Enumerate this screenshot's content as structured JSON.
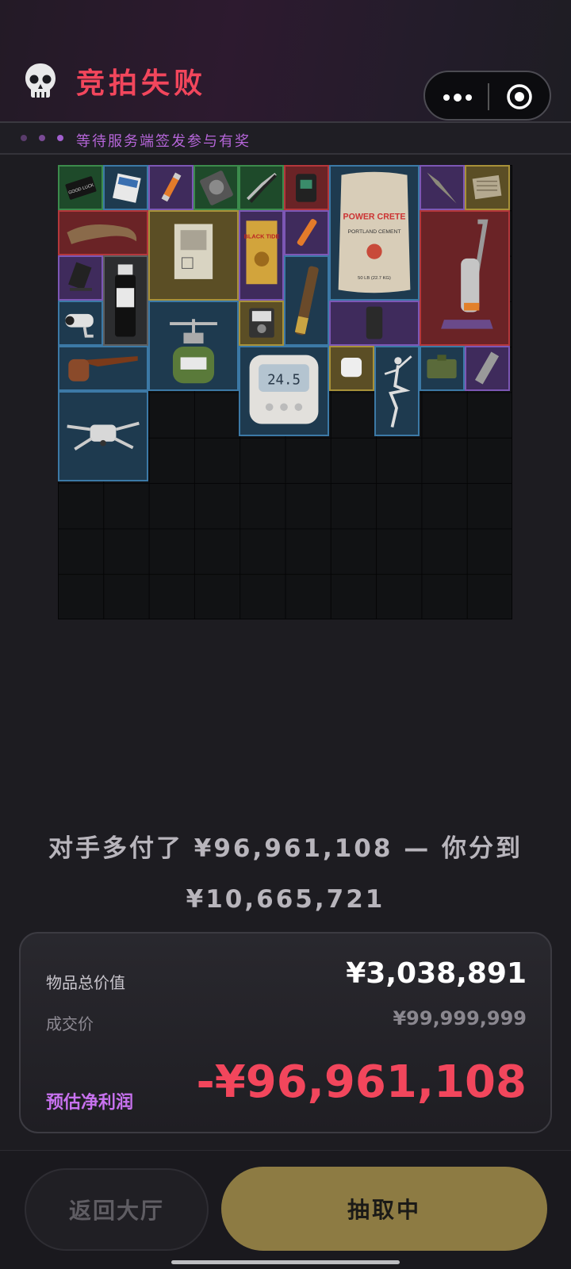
{
  "header": {
    "title": "竞拍失败",
    "status_text": "等待服务端签发参与有奖",
    "icons": [
      "skull-icon",
      "more-icon",
      "target-icon"
    ]
  },
  "inventory": {
    "grid_columns": 10,
    "grid_rows": 10,
    "items": [
      {
        "name": "good-luck-card",
        "rarity": "green",
        "label": "GOOD LUCK"
      },
      {
        "name": "memory-card",
        "rarity": "blue"
      },
      {
        "name": "fuse",
        "rarity": "purple"
      },
      {
        "name": "hard-drive",
        "rarity": "green"
      },
      {
        "name": "pliers",
        "rarity": "green"
      },
      {
        "name": "wrist-device",
        "rarity": "red"
      },
      {
        "name": "cement-bag",
        "rarity": "blue",
        "label_line1": "POWER CRETE",
        "label_line2": "PORTLAND CEMENT",
        "label_line3": "50 LB (22.7 KG)"
      },
      {
        "name": "spear-head",
        "rarity": "purple"
      },
      {
        "name": "circuit-module",
        "rarity": "gold"
      },
      {
        "name": "horn",
        "rarity": "red"
      },
      {
        "name": "document-folder",
        "rarity": "gold"
      },
      {
        "name": "black-tide-book",
        "rarity": "purple",
        "label": "BLACK TIDE"
      },
      {
        "name": "fuse-small",
        "rarity": "purple"
      },
      {
        "name": "vacuum-cleaner",
        "rarity": "red"
      },
      {
        "name": "phone-mount",
        "rarity": "purple"
      },
      {
        "name": "sample-bottle",
        "rarity": "gray"
      },
      {
        "name": "telescope",
        "rarity": "blue"
      },
      {
        "name": "security-camera",
        "rarity": "blue"
      },
      {
        "name": "camp-stove",
        "rarity": "blue"
      },
      {
        "name": "meter-device",
        "rarity": "gold"
      },
      {
        "name": "armor-plate",
        "rarity": "purple"
      },
      {
        "name": "smoking-pipe",
        "rarity": "blue"
      },
      {
        "name": "digital-thermometer",
        "rarity": "blue",
        "label": "24.5"
      },
      {
        "name": "smart-sensor",
        "rarity": "gold"
      },
      {
        "name": "ballerina-statue",
        "rarity": "blue"
      },
      {
        "name": "ammo-box",
        "rarity": "blue"
      },
      {
        "name": "metal-plate",
        "rarity": "purple"
      },
      {
        "name": "drone",
        "rarity": "blue"
      }
    ]
  },
  "result": {
    "summary_line1": "对手多付了 ¥96,961,108 — 你分到",
    "summary_line2": "¥10,665,721",
    "total_value_label": "物品总价值",
    "total_value": "¥3,038,891",
    "deal_price_label": "成交价",
    "deal_price": "¥99,999,999",
    "profit_label": "预估净利润",
    "profit": "-¥96,961,108"
  },
  "actions": {
    "lobby_label": "返回大厅",
    "draw_label": "抽取中"
  },
  "colors": {
    "accent_red": "#f2465c",
    "accent_purple": "#c872ef",
    "button_gold": "#8d7b43"
  }
}
